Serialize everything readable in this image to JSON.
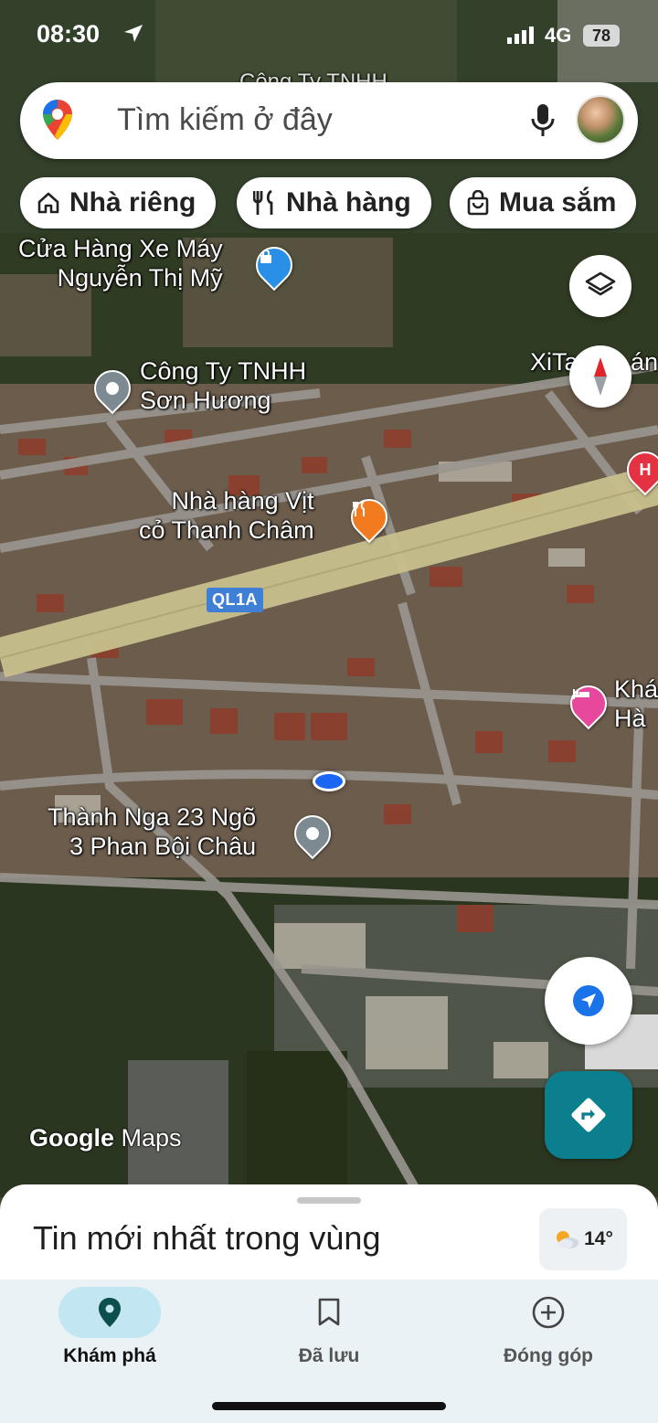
{
  "status_bar": {
    "time": "08:30",
    "network": "4G",
    "battery": "78"
  },
  "search": {
    "placeholder": "Tìm kiếm ở đây"
  },
  "chips": [
    {
      "label": "Nhà riêng",
      "icon": "home-icon"
    },
    {
      "label": "Nhà hàng",
      "icon": "restaurant-icon"
    },
    {
      "label": "Mua sắm",
      "icon": "shopping-bag-icon"
    }
  ],
  "map": {
    "top_partial_label": "Công Ty TNHH",
    "labels": {
      "shop": [
        "Cửa Hàng Xe Máy",
        "Nguyễn Thị Mỹ"
      ],
      "company": [
        "Công Ty TNHH",
        "Sơn Hương"
      ],
      "restaurant": [
        "Nhà hàng Vịt",
        "cỏ Thanh Châm"
      ],
      "right_top": "XiTa",
      "right_top_2": "án",
      "hotel": [
        "Khá",
        "Hà"
      ],
      "place": [
        "Thành Nga 23 Ngõ",
        "3 Phan Bội Châu"
      ]
    },
    "road_shield": "QL1A",
    "hospital_marker": "H",
    "colors": {
      "shop_pin": "#2a8fe6",
      "company_pin": "#7d8a92",
      "restaurant_pin": "#f27b20",
      "hotel_pin": "#e8489c",
      "hospital_pin": "#e53242",
      "my_location": "#1a66f5"
    }
  },
  "brand": {
    "google": "Google",
    "maps": "Maps"
  },
  "sheet": {
    "title": "Tin mới nhất trong vùng",
    "weather": "14°"
  },
  "bottom_nav": [
    {
      "label": "Khám phá",
      "icon": "explore-pin-icon",
      "active": true
    },
    {
      "label": "Đã lưu",
      "icon": "bookmark-icon",
      "active": false
    },
    {
      "label": "Đóng góp",
      "icon": "add-circle-icon",
      "active": false
    }
  ]
}
